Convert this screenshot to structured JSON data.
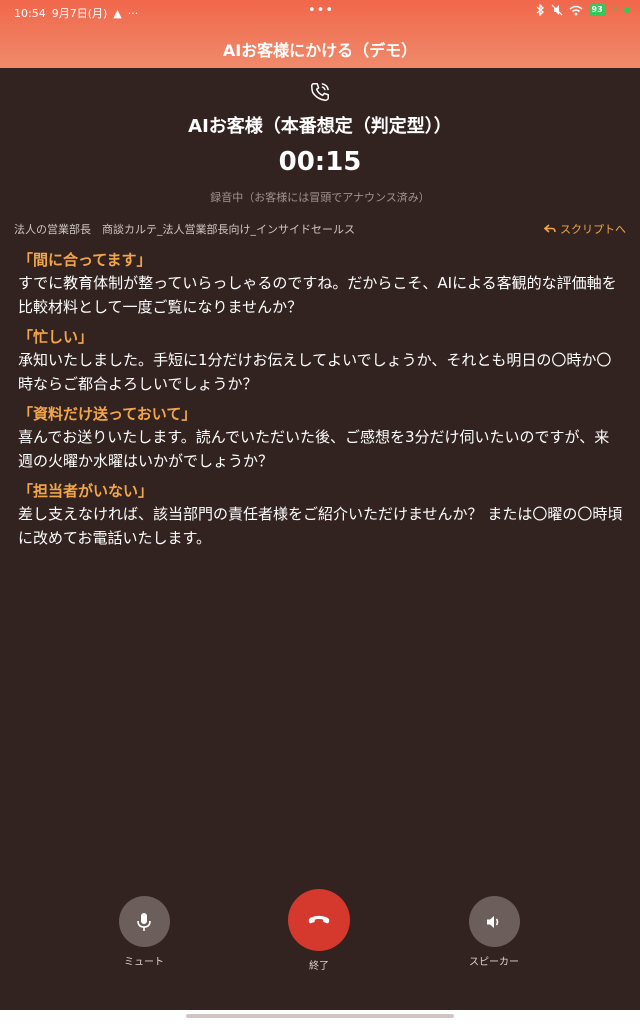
{
  "status_bar": {
    "time": "10:54",
    "date": "9月7日(月)",
    "warning": "▲",
    "dots": "···",
    "center_dots": "•••",
    "battery": "93"
  },
  "header": {
    "title": "AIお客様にかける（デモ）"
  },
  "call": {
    "caller_name": "AIお客様（本番想定（判定型））",
    "timer": "00:15",
    "recording_note": "録音中（お客様には冒頭でアナウンス済み）"
  },
  "meta": {
    "info": "法人の営業部長　商談カルテ_法人営業部長向け_インサイドセールス",
    "script_link": "スクリプトへ"
  },
  "scripts": [
    {
      "heading": "「間に合ってます」",
      "body": "すでに教育体制が整っていらっしゃるのですね。だからこそ、AIによる客観的な評価軸を比較材料として一度ご覧になりませんか？"
    },
    {
      "heading": "「忙しい」",
      "body": "承知いたしました。手短に1分だけお伝えしてよいでしょうか、それとも明日の〇時か〇時ならご都合よろしいでしょうか？"
    },
    {
      "heading": "「資料だけ送っておいて」",
      "body": "喜んでお送りいたします。読んでいただいた後、ご感想を3分だけ伺いたいのですが、来週の火曜か水曜はいかがでしょうか？"
    },
    {
      "heading": "「担当者がいない」",
      "body": "差し支えなければ、該当部門の責任者様をご紹介いただけませんか？ または〇曜の〇時頃に改めてお電話いたします。"
    }
  ],
  "controls": {
    "mute_label": "ミュート",
    "end_label": "終了",
    "speaker_label": "スピーカー"
  },
  "colors": {
    "header_gradient_top": "#f1674b",
    "background": "#322320",
    "accent": "#f3a54a",
    "end_call": "#d5392e"
  }
}
